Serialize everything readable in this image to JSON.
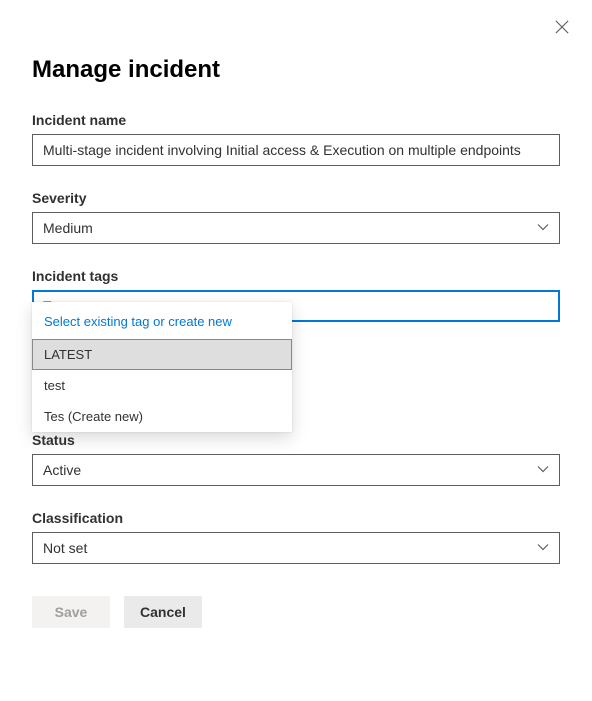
{
  "header": {
    "title": "Manage incident"
  },
  "fields": {
    "incidentName": {
      "label": "Incident name",
      "value": "Multi-stage incident involving Initial access & Execution on multiple endpoints"
    },
    "severity": {
      "label": "Severity",
      "value": "Medium"
    },
    "tags": {
      "label": "Incident tags",
      "value": "Tes",
      "dropdown": {
        "prompt": "Select existing tag or create new",
        "options": [
          "LATEST",
          "test",
          "Tes (Create new)"
        ],
        "highlightedIndex": 0
      }
    },
    "status": {
      "label": "Status",
      "value": "Active"
    },
    "classification": {
      "label": "Classification",
      "value": "Not set"
    }
  },
  "buttons": {
    "save": "Save",
    "cancel": "Cancel"
  }
}
